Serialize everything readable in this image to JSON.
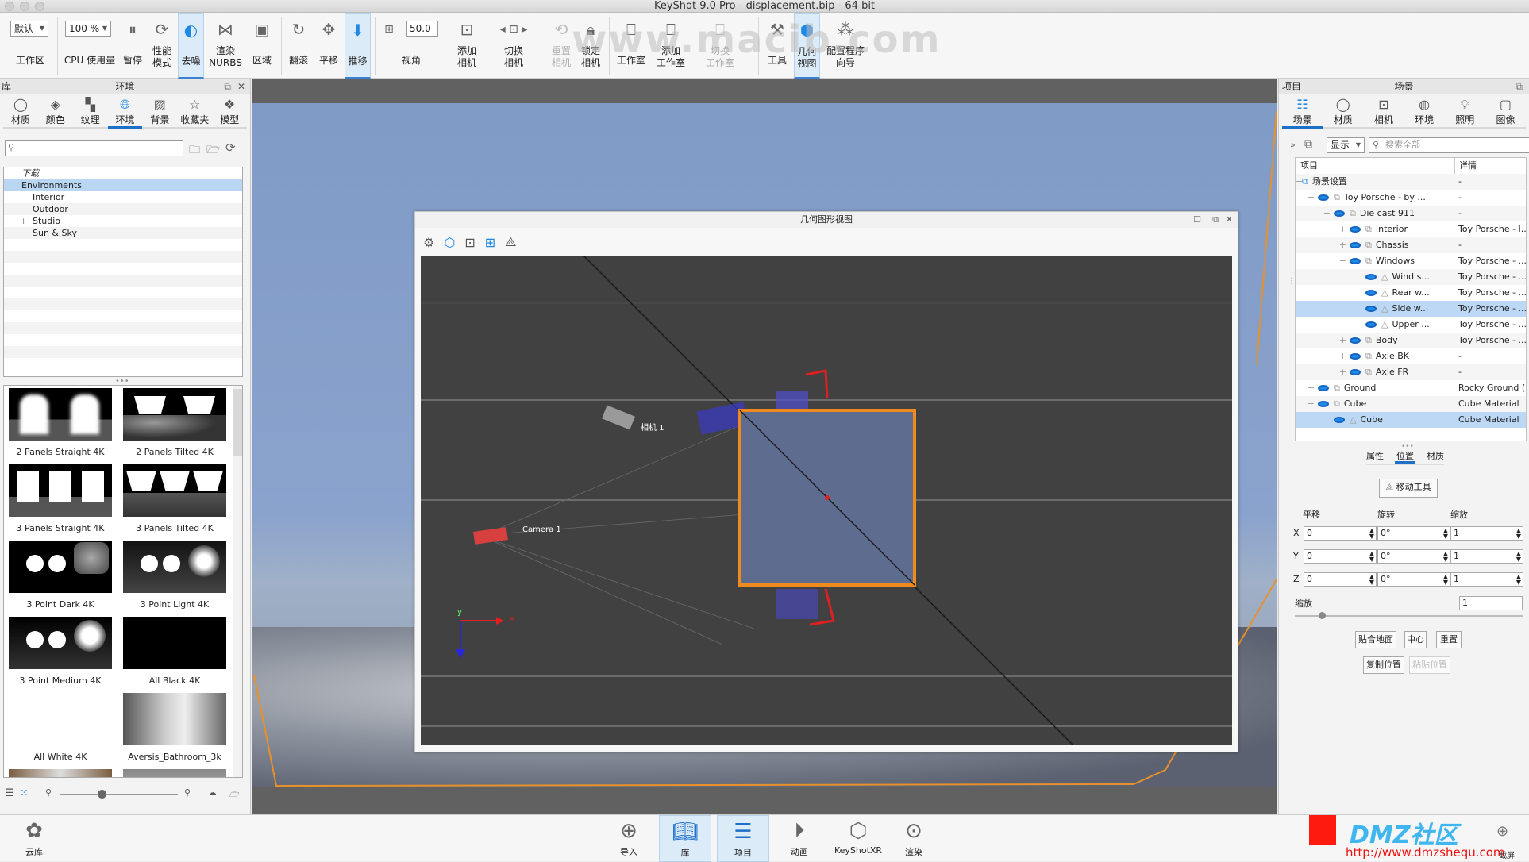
{
  "window": {
    "title": "KeyShot 9.0 Pro  - displacement.bip  - 64 bit"
  },
  "toolbar": {
    "workspace_value": "默认",
    "workspace_label": "工作区",
    "cpu_value": "100 %",
    "cpu_label": "CPU 使用量",
    "pause": "暂停",
    "perf_mode": "性能\n模式",
    "denoise": "去噪",
    "render_nurbs": "渲染\nNURBS",
    "region": "区域",
    "tumble": "翻滚",
    "pan": "平移",
    "dolly": "推移",
    "fov_value": "50.0",
    "fov_label": "视角",
    "add_camera": "添加\n相机",
    "switch_camera": "切换\n相机",
    "reset_camera": "重置\n相机",
    "lock_camera": "锁定\n相机",
    "studio": "工作室",
    "add_studio": "添加\n工作室",
    "switch_studio": "切换\n工作室",
    "tools": "工具",
    "geometry_view": "几何\n视图",
    "config_wizard": "配置程序\n向导"
  },
  "library": {
    "panel_title": "库",
    "header": "环境",
    "tabs": [
      {
        "label": "材质",
        "icon": "material-icon"
      },
      {
        "label": "颜色",
        "icon": "color-icon"
      },
      {
        "label": "纹理",
        "icon": "texture-icon"
      },
      {
        "label": "环境",
        "icon": "environment-icon",
        "active": true
      },
      {
        "label": "背景",
        "icon": "background-icon"
      },
      {
        "label": "收藏夹",
        "icon": "favorites-icon"
      },
      {
        "label": "模型",
        "icon": "models-icon"
      }
    ],
    "search_placeholder": "",
    "tree": [
      {
        "label": "下载",
        "level": 0
      },
      {
        "label": "Environments",
        "level": 0,
        "selected": true,
        "expanded": true
      },
      {
        "label": "Interior",
        "level": 1
      },
      {
        "label": "Outdoor",
        "level": 1
      },
      {
        "label": "Studio",
        "level": 1,
        "expandable": true
      },
      {
        "label": "Sun & Sky",
        "level": 1
      }
    ],
    "thumbnails": [
      "2 Panels Straight 4K",
      "2 Panels Tilted 4K",
      "3 Panels Straight 4K",
      "3 Panels Tilted 4K",
      "3 Point Dark 4K",
      "3 Point Light 4K",
      "3 Point Medium 4K",
      "All Black 4K",
      "All White 4K",
      "Aversis_Bathroom_3k"
    ],
    "cloud_label": "云库"
  },
  "geometry_view": {
    "title": "几何图形视图",
    "labels": {
      "camera_a": "相机 1",
      "camera_b": "Camera 1",
      "axis_x": "x",
      "axis_y": "y"
    }
  },
  "project": {
    "panel_title": "项目",
    "header": "场景",
    "tabs": [
      {
        "label": "场景",
        "active": true
      },
      {
        "label": "材质"
      },
      {
        "label": "相机"
      },
      {
        "label": "环境"
      },
      {
        "label": "照明"
      },
      {
        "label": "图像"
      }
    ],
    "show_dropdown": "显示",
    "search_placeholder": "搜索全部",
    "columns": [
      "项目",
      "详情"
    ],
    "tree": [
      {
        "name": "场景设置",
        "detail": "-",
        "level": 0,
        "toggle": "−"
      },
      {
        "name": "Toy Porsche - by ...",
        "detail": "-",
        "level": 1,
        "toggle": "−"
      },
      {
        "name": "Die cast 911",
        "detail": "-",
        "level": 2,
        "toggle": "−"
      },
      {
        "name": "Interior",
        "detail": "Toy Porsche - I...",
        "level": 3,
        "toggle": "+"
      },
      {
        "name": "Chassis",
        "detail": "-",
        "level": 3,
        "toggle": "+"
      },
      {
        "name": "Windows",
        "detail": "Toy Porsche - ...",
        "level": 3,
        "toggle": "−"
      },
      {
        "name": "Wind s...",
        "detail": "Toy Porsche - ...",
        "level": 4,
        "toggle": ""
      },
      {
        "name": "Rear w...",
        "detail": "Toy Porsche - ...",
        "level": 4,
        "toggle": ""
      },
      {
        "name": "Side w...",
        "detail": "Toy Porsche - ...",
        "level": 4,
        "toggle": "",
        "selected": true
      },
      {
        "name": "Upper ...",
        "detail": "Toy Porsche - ...",
        "level": 4,
        "toggle": ""
      },
      {
        "name": "Body",
        "detail": "Toy Porsche - ...",
        "level": 3,
        "toggle": "+"
      },
      {
        "name": "Axle BK",
        "detail": "-",
        "level": 3,
        "toggle": "+"
      },
      {
        "name": "Axle FR",
        "detail": "-",
        "level": 3,
        "toggle": "+"
      },
      {
        "name": "Ground",
        "detail": "Rocky Ground (",
        "level": 1,
        "toggle": "+"
      },
      {
        "name": "Cube",
        "detail": "Cube Material",
        "level": 1,
        "toggle": "−"
      },
      {
        "name": "Cube",
        "detail": "Cube Material",
        "level": 2,
        "toggle": "",
        "selected": true
      }
    ],
    "subtabs": [
      "属性",
      "位置",
      "材质"
    ],
    "move_tool": "移动工具",
    "position": {
      "headers": [
        "平移",
        "旋转",
        "缩放"
      ],
      "rows": [
        {
          "axis": "X",
          "translate": "0",
          "rotate": "0°",
          "scale": "1"
        },
        {
          "axis": "Y",
          "translate": "0",
          "rotate": "0°",
          "scale": "1"
        },
        {
          "axis": "Z",
          "translate": "0",
          "rotate": "0°",
          "scale": "1"
        }
      ],
      "uniform_scale_label": "缩放",
      "uniform_scale_value": "1",
      "slider_fraction": 0.12
    },
    "buttons": [
      "贴合地面",
      "中心",
      "重置",
      "复制位置",
      "粘贴位置"
    ]
  },
  "ribbon": [
    {
      "label": "导入",
      "icon": "import-icon"
    },
    {
      "label": "库",
      "icon": "library-icon",
      "active": true
    },
    {
      "label": "项目",
      "icon": "project-icon",
      "active": true
    },
    {
      "label": "动画",
      "icon": "animation-icon"
    },
    {
      "label": "KeyShotXR",
      "icon": "keyshotxr-icon"
    },
    {
      "label": "渲染",
      "icon": "render-icon"
    }
  ],
  "screenshot_label": "截屏",
  "watermark": {
    "text": "www.macib.com",
    "logo_text": "DMZ社区",
    "logo_url": "http://www.dmzshequ.com"
  },
  "zoom_slider_fraction": 0.35
}
